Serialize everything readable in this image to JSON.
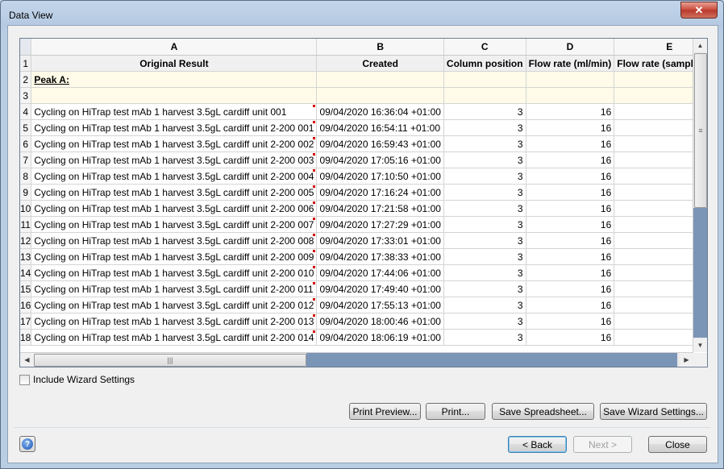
{
  "window": {
    "title": "Data View",
    "close_glyph": "✕"
  },
  "grid": {
    "columns": [
      "A",
      "B",
      "C",
      "D",
      "E"
    ],
    "header_row": {
      "num": "1",
      "cells": [
        "Original Result",
        "Created",
        "Column position",
        "Flow rate (ml/min)",
        "Flow rate (sample pum"
      ]
    },
    "peak_row": {
      "num": "2",
      "label": "Peak A:"
    },
    "blank_row": {
      "num": "3"
    },
    "rows": [
      {
        "num": "4",
        "result": "Cycling on HiTrap test mAb 1 harvest 3.5gL cardiff unit  001",
        "created": "09/04/2020 16:36:04 +01:00",
        "colpos": "3",
        "flow": "16",
        "flow_sample": ""
      },
      {
        "num": "5",
        "result": "Cycling on HiTrap test mAb 1 harvest 3.5gL cardiff unit 2-200 001",
        "created": "09/04/2020 16:54:11 +01:00",
        "colpos": "3",
        "flow": "16",
        "flow_sample": ""
      },
      {
        "num": "6",
        "result": "Cycling on HiTrap test mAb 1 harvest 3.5gL cardiff unit 2-200 002",
        "created": "09/04/2020 16:59:43 +01:00",
        "colpos": "3",
        "flow": "16",
        "flow_sample": ""
      },
      {
        "num": "7",
        "result": "Cycling on HiTrap test mAb 1 harvest 3.5gL cardiff unit 2-200 003",
        "created": "09/04/2020 17:05:16 +01:00",
        "colpos": "3",
        "flow": "16",
        "flow_sample": ""
      },
      {
        "num": "8",
        "result": "Cycling on HiTrap test mAb 1 harvest 3.5gL cardiff unit 2-200 004",
        "created": "09/04/2020 17:10:50 +01:00",
        "colpos": "3",
        "flow": "16",
        "flow_sample": ""
      },
      {
        "num": "9",
        "result": "Cycling on HiTrap test mAb 1 harvest 3.5gL cardiff unit 2-200 005",
        "created": "09/04/2020 17:16:24 +01:00",
        "colpos": "3",
        "flow": "16",
        "flow_sample": ""
      },
      {
        "num": "10",
        "result": "Cycling on HiTrap test mAb 1 harvest 3.5gL cardiff unit 2-200 006",
        "created": "09/04/2020 17:21:58 +01:00",
        "colpos": "3",
        "flow": "16",
        "flow_sample": ""
      },
      {
        "num": "11",
        "result": "Cycling on HiTrap test mAb 1 harvest 3.5gL cardiff unit 2-200 007",
        "created": "09/04/2020 17:27:29 +01:00",
        "colpos": "3",
        "flow": "16",
        "flow_sample": ""
      },
      {
        "num": "12",
        "result": "Cycling on HiTrap test mAb 1 harvest 3.5gL cardiff unit 2-200 008",
        "created": "09/04/2020 17:33:01 +01:00",
        "colpos": "3",
        "flow": "16",
        "flow_sample": ""
      },
      {
        "num": "13",
        "result": "Cycling on HiTrap test mAb 1 harvest 3.5gL cardiff unit 2-200 009",
        "created": "09/04/2020 17:38:33 +01:00",
        "colpos": "3",
        "flow": "16",
        "flow_sample": ""
      },
      {
        "num": "14",
        "result": "Cycling on HiTrap test mAb 1 harvest 3.5gL cardiff unit 2-200 010",
        "created": "09/04/2020 17:44:06 +01:00",
        "colpos": "3",
        "flow": "16",
        "flow_sample": ""
      },
      {
        "num": "15",
        "result": "Cycling on HiTrap test mAb 1 harvest 3.5gL cardiff unit 2-200 011",
        "created": "09/04/2020 17:49:40 +01:00",
        "colpos": "3",
        "flow": "16",
        "flow_sample": ""
      },
      {
        "num": "16",
        "result": "Cycling on HiTrap test mAb 1 harvest 3.5gL cardiff unit 2-200 012",
        "created": "09/04/2020 17:55:13 +01:00",
        "colpos": "3",
        "flow": "16",
        "flow_sample": ""
      },
      {
        "num": "17",
        "result": "Cycling on HiTrap test mAb 1 harvest 3.5gL cardiff unit 2-200 013",
        "created": "09/04/2020 18:00:46 +01:00",
        "colpos": "3",
        "flow": "16",
        "flow_sample": ""
      },
      {
        "num": "18",
        "result": "Cycling on HiTrap test mAb 1 harvest 3.5gL cardiff unit 2-200 014",
        "created": "09/04/2020 18:06:19 +01:00",
        "colpos": "3",
        "flow": "16",
        "flow_sample": ""
      }
    ]
  },
  "scrollbars": {
    "up_arrow": "▲",
    "down_arrow": "▼",
    "left_arrow": "◀",
    "right_arrow": "▶",
    "grip_v": "≡",
    "grip_h": "|||"
  },
  "options": {
    "include_wizard_settings": {
      "label": "Include Wizard Settings",
      "checked": false
    }
  },
  "actions": {
    "print_preview": "Print Preview...",
    "print": "Print...",
    "save_spreadsheet": "Save Spreadsheet...",
    "save_wizard_settings": "Save Wizard Settings..."
  },
  "footer": {
    "help_icon": "?",
    "back": "< Back",
    "next": "Next >",
    "close": "Close"
  },
  "colors": {
    "window_frame": "#b9cde3",
    "scroll_track": "#7b95b7",
    "yellow_rows": "#fffbe8"
  }
}
